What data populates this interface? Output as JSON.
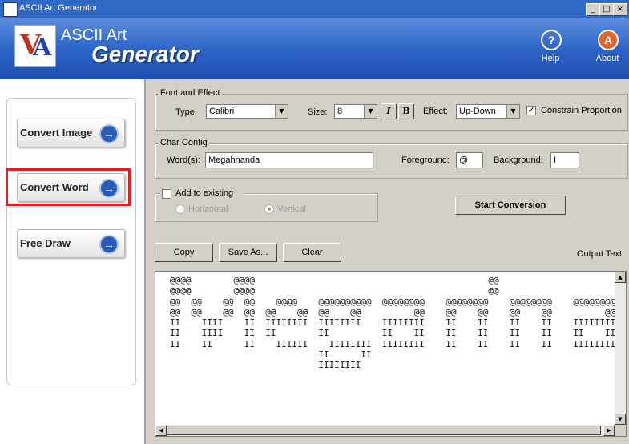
{
  "window": {
    "title": "ASCII Art Generator",
    "min": "_",
    "max": "□",
    "close": "×"
  },
  "header": {
    "app_line1": "ASCII Art",
    "app_line2": "Generator",
    "help": {
      "label": "Help",
      "glyph": "?"
    },
    "about": {
      "label": "About",
      "glyph": "A"
    }
  },
  "nav": {
    "convert_image": "Convert Image",
    "convert_word": "Convert Word",
    "free_draw": "Free Draw",
    "selected": "Convert Word"
  },
  "font_effect": {
    "legend": "Font and Effect",
    "type_label": "Type:",
    "type_value": "Calibri",
    "size_label": "Size:",
    "size_value": "8",
    "italic": "I",
    "bold": "B",
    "effect_label": "Effect:",
    "effect_value": "Up-Down",
    "constrain_label": "Constrain Proportion",
    "constrain_checked": true
  },
  "char_config": {
    "legend": "Char Config",
    "words_label": "Word(s):",
    "words_value": "Megahnanda",
    "foreground_label": "Foreground:",
    "foreground_value": "@",
    "background_label": "Background:",
    "background_value": "I"
  },
  "add_existing": {
    "label": "Add to existing",
    "checked": false,
    "horizontal": "Horizontal",
    "vertical": "Vertical",
    "selected": "Vertical"
  },
  "actions": {
    "start": "Start Conversion",
    "copy": "Copy",
    "save_as": "Save As...",
    "clear": "Clear",
    "output_label": "Output Text"
  },
  "output_lines": [
    "@@@@        @@@@                                            @@",
    "@@@@        @@@@                                            @@",
    "@@  @@    @@  @@    @@@@    @@@@@@@@@@  @@@@@@@@    @@@@@@@@    @@@@@@@@    @@@@@@@@",
    "@@  @@    @@  @@  @@    @@  @@    @@          @@    @@    @@    @@    @@          @@",
    "II    IIII    II  IIIIIIII  IIIIIIII    IIIIIIII    II    II    II    II    IIIIIIII",
    "II    IIII    II  II        II          II    II    II    II    II    II    II    II",
    "II    II      II    IIIIII    IIIIIIII  IIIIIIII    II    II    II    II    IIIIIIII",
    "                            II      II",
    "                            IIIIIIII"
  ]
}
